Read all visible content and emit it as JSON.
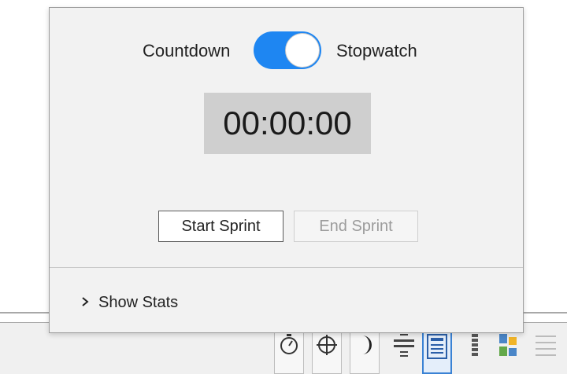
{
  "timer": {
    "mode_left_label": "Countdown",
    "mode_right_label": "Stopwatch",
    "mode_selected": "Stopwatch",
    "display": "00:00:00",
    "start_label": "Start Sprint",
    "end_label": "End Sprint",
    "end_enabled": false
  },
  "stats": {
    "toggle_label": "Show Stats",
    "expanded": false
  },
  "statusbar": {
    "icons": [
      "stopwatch-icon",
      "target-icon",
      "moon-icon",
      "align-center-icon",
      "page-layout-icon",
      "column-icon",
      "shapes-icon",
      "list-icon"
    ],
    "active_icon": "page-layout-icon"
  },
  "colors": {
    "toggle_on": "#1e86f2",
    "popup_bg": "#f2f2f2",
    "timer_bg": "#cfcfcf",
    "active_icon_border": "#3a82d4"
  }
}
